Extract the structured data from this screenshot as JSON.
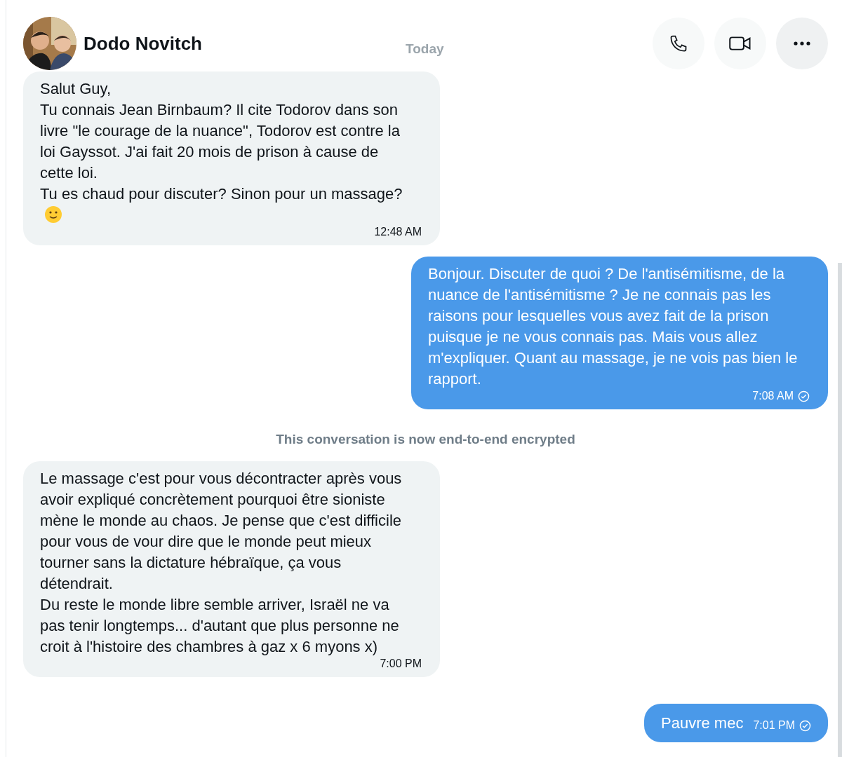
{
  "header": {
    "name": "Dodo Novitch",
    "date_label": "Today"
  },
  "messages": [
    {
      "kind": "received",
      "text": "Salut Guy,\nTu connais Jean Birnbaum? Il cite Todorov dans son livre \"le courage de la nuance\", Todorov est contre la loi Gayssot. J'ai fait 20 mois de prison à cause de cette loi.\nTu es chaud pour discuter? Sinon pour un massage?",
      "time": "12:48 AM",
      "emoji": true
    },
    {
      "kind": "sent",
      "text": "Bonjour. Discuter de quoi ? De l'antisémitisme, de la nuance de l'antisémitisme ? Je ne connais pas les raisons pour lesquelles vous avez fait de la prison puisque je ne vous connais pas. Mais vous allez m'expliquer. Quant au massage, je ne vois pas bien le rapport.",
      "time": "7:08 AM",
      "seen": true
    },
    {
      "kind": "notice",
      "text": "This conversation is now end-to-end encrypted"
    },
    {
      "kind": "received",
      "text": "Le massage c'est pour vous décontracter après vous avoir expliqué concrètement pourquoi être sioniste mène le monde au chaos. Je pense que c'est difficile pour vous de vour dire que le monde peut mieux tourner sans la dictature hébraïque, ça vous détendrait.\nDu reste le monde libre semble arriver, Israël ne va pas tenir longtemps... d'autant que plus personne ne croit à l'histoire des chambres à gaz x 6 myons x)",
      "time": "7:00 PM"
    },
    {
      "kind": "sent",
      "text": "Pauvre mec",
      "time": "7:01 PM",
      "seen": true,
      "inline": true
    }
  ]
}
